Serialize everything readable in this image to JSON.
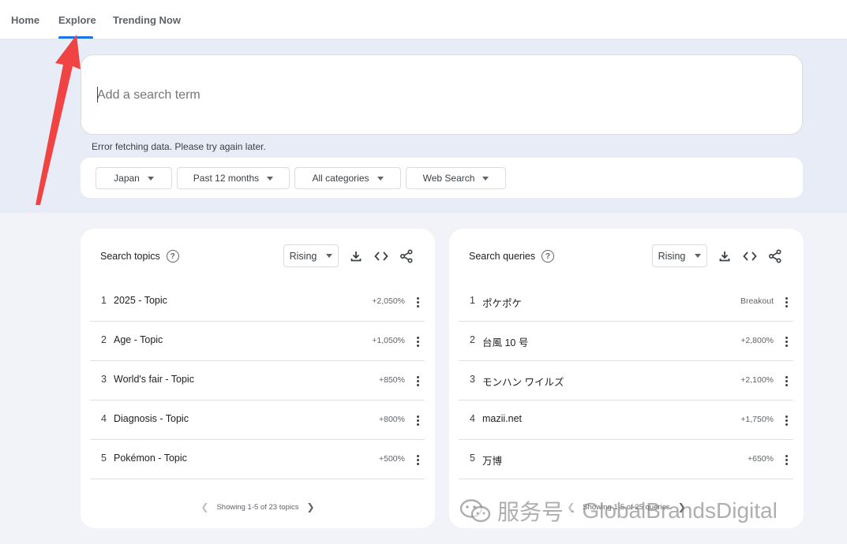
{
  "nav": {
    "tabs": [
      {
        "label": "Home"
      },
      {
        "label": "Explore"
      },
      {
        "label": "Trending Now"
      }
    ]
  },
  "search": {
    "placeholder": "Add a search term",
    "error": "Error fetching data. Please try again later."
  },
  "filters": {
    "region": "Japan",
    "time": "Past 12 months",
    "category": "All categories",
    "property": "Web Search"
  },
  "topics_panel": {
    "title": "Search topics",
    "sort": "Rising",
    "rows": [
      {
        "rank": "1",
        "label": "2025 - Topic",
        "value": "+2,050%"
      },
      {
        "rank": "2",
        "label": "Age - Topic",
        "value": "+1,050%"
      },
      {
        "rank": "3",
        "label": "World's fair - Topic",
        "value": "+850%"
      },
      {
        "rank": "4",
        "label": "Diagnosis - Topic",
        "value": "+800%"
      },
      {
        "rank": "5",
        "label": "Pokémon - Topic",
        "value": "+500%"
      }
    ],
    "pager": "Showing 1-5 of 23 topics"
  },
  "queries_panel": {
    "title": "Search queries",
    "sort": "Rising",
    "rows": [
      {
        "rank": "1",
        "label": "ポケポケ",
        "value": "Breakout"
      },
      {
        "rank": "2",
        "label": "台風 10 号",
        "value": "+2,800%"
      },
      {
        "rank": "3",
        "label": "モンハン ワイルズ",
        "value": "+2,100%"
      },
      {
        "rank": "4",
        "label": "mazii.net",
        "value": "+1,750%"
      },
      {
        "rank": "5",
        "label": "万博",
        "value": "+650%"
      }
    ],
    "pager": "Showing 1-5 of 25 queries"
  },
  "watermark": {
    "channel": "服务号",
    "sep": "·",
    "name": "GlobalBrandsDigital"
  },
  "colors": {
    "accent": "#1a73e8",
    "annotation_arrow": "#f04444"
  }
}
